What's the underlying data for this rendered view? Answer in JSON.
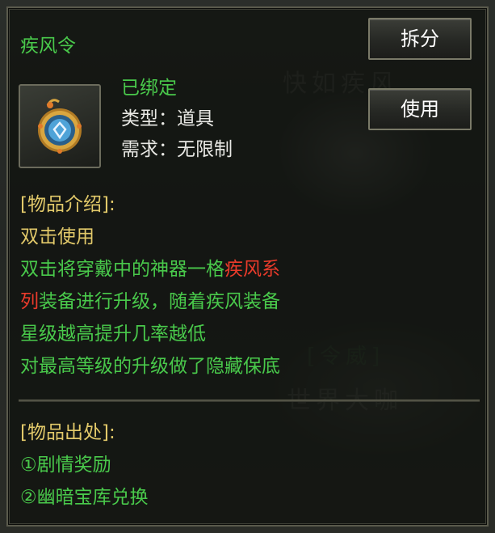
{
  "item": {
    "name": "疾风令",
    "bound_status": "已绑定",
    "type_label": "类型：",
    "type_value": "道具",
    "req_label": "需求：",
    "req_value": "无限制",
    "icon": "wind-token-amulet-icon"
  },
  "buttons": {
    "split": "拆分",
    "use": "使用"
  },
  "intro": {
    "header": "[物品介绍]:",
    "usage": "双击使用",
    "line1_green": "双击将穿戴中的神器一格",
    "line1_red": "疾风系",
    "line2_red": "列",
    "line2_green": "装备进行升级，随着疾风装备",
    "line3": "星级越高提升几率越低",
    "line4": "对最高等级的升级做了隐藏保底"
  },
  "source": {
    "header": "[物品出处]:",
    "items": [
      "①剧情奖励",
      "②幽暗宝库兑换"
    ]
  },
  "colors": {
    "green": "#49c94b",
    "gold": "#e2c96a",
    "red": "#ea3b2b",
    "white": "#e8e8e4"
  }
}
